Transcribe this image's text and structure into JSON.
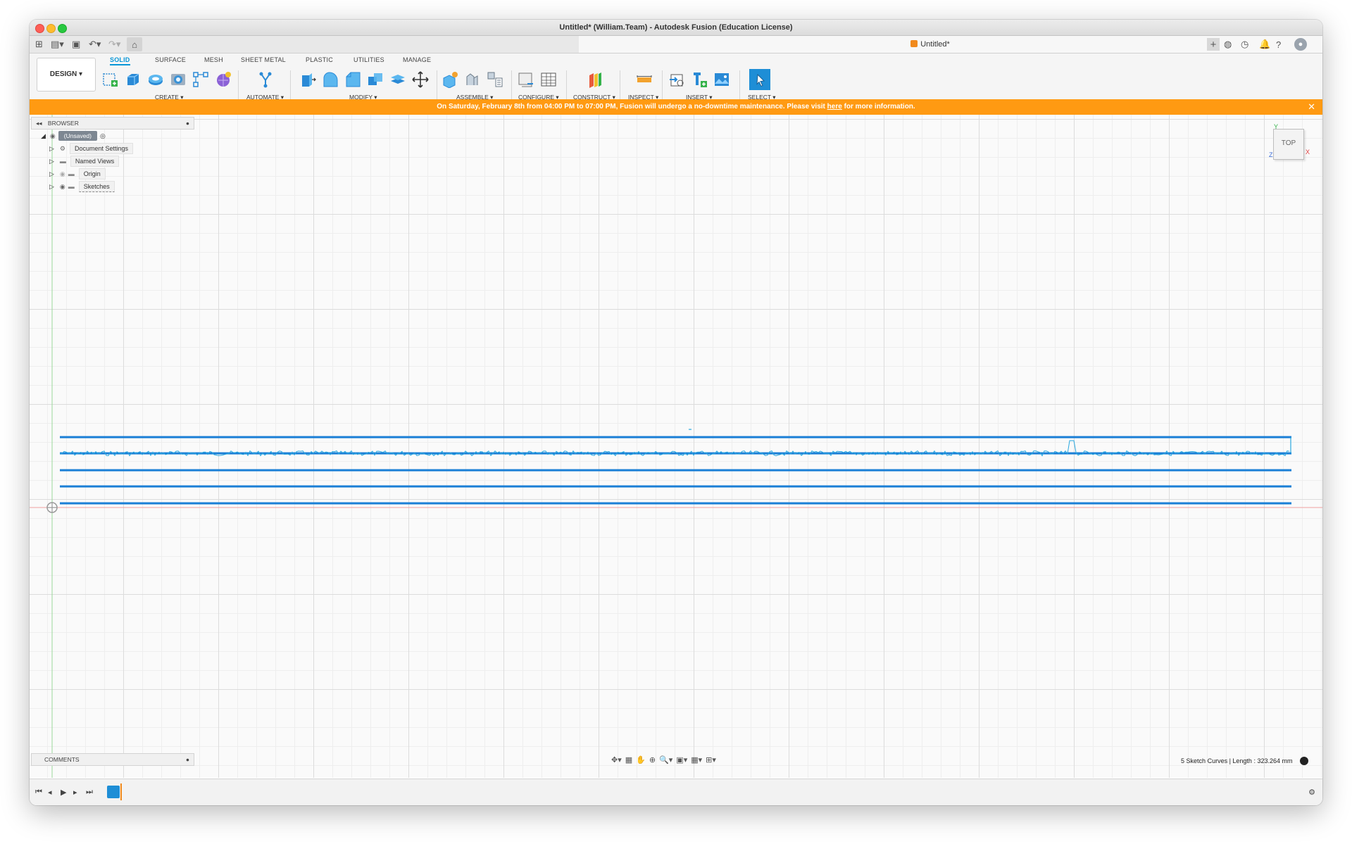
{
  "window": {
    "title": "Untitled* (William.Team) - Autodesk Fusion (Education License)"
  },
  "tabbar": {
    "document_tab": "Untitled*"
  },
  "toolbar": {
    "design_mode": "DESIGN ▾",
    "workspace_tabs": [
      "SOLID",
      "SURFACE",
      "MESH",
      "SHEET METAL",
      "PLASTIC",
      "UTILITIES",
      "MANAGE"
    ],
    "groups": [
      "CREATE ▾",
      "AUTOMATE ▾",
      "MODIFY ▾",
      "ASSEMBLE ▾",
      "CONFIGURE ▾",
      "CONSTRUCT ▾",
      "INSPECT ▾",
      "INSERT ▾",
      "SELECT ▾"
    ]
  },
  "banner": {
    "text_before": "On Saturday, February 8th from 04:00 PM to 07:00 PM, Fusion will undergo a no-downtime maintenance. Please visit ",
    "link": "here",
    "text_after": " for more information.",
    "color": "#ff9a12"
  },
  "browser": {
    "title": "BROWSER",
    "root": "(Unsaved)",
    "items": [
      "Document Settings",
      "Named Views",
      "Origin",
      "Sketches"
    ]
  },
  "viewcube": {
    "face": "TOP",
    "axes": [
      "Y",
      "X",
      "Z"
    ]
  },
  "comments": {
    "title": "COMMENTS"
  },
  "status": {
    "text": "5 Sketch Curves | Length : 323.264 mm"
  },
  "colors": {
    "accent": "#0696d7",
    "sketch_line": "#1a7fd6",
    "noise_curve": "#29a8e0"
  },
  "icons": {
    "file": "file-icon",
    "save": "save-icon",
    "undo": "undo-icon",
    "redo": "redo-icon",
    "home": "home-icon",
    "settings": "gear-icon",
    "help": "help-icon",
    "notifications": "bell-icon"
  }
}
